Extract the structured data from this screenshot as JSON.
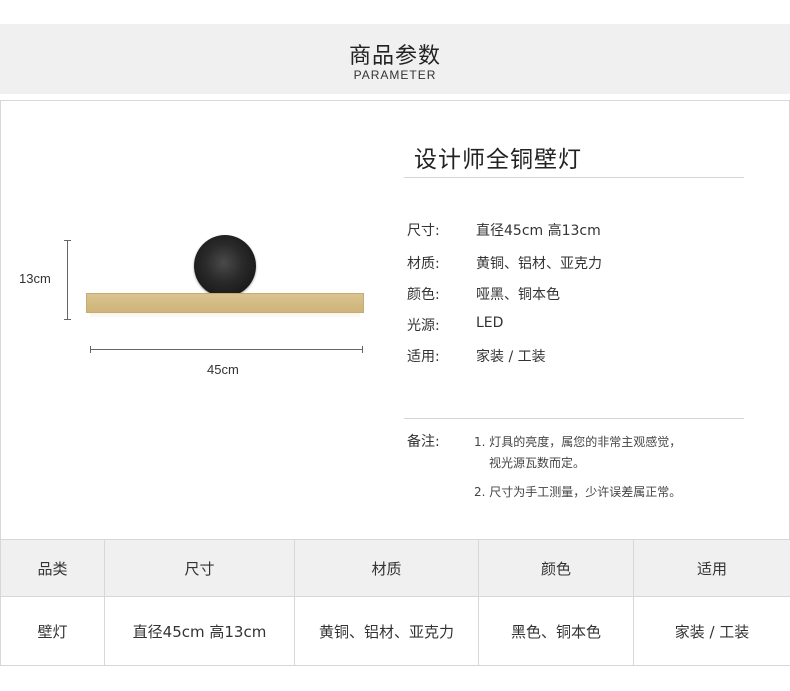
{
  "header": {
    "title": "商品参数",
    "subtitle": "PARAMETER"
  },
  "illustration": {
    "height_label": "13cm",
    "width_label": "45cm"
  },
  "product": {
    "title": "设计师全铜壁灯",
    "specs": [
      {
        "label": "尺寸:",
        "value": "直径45cm 高13cm"
      },
      {
        "label": "材质:",
        "value": "黄铜、铝材、亚克力"
      },
      {
        "label": "颜色:",
        "value": "哑黑、铜本色"
      },
      {
        "label": "光源:",
        "value": "LED"
      },
      {
        "label": "适用:",
        "value": "家装 / 工装"
      }
    ],
    "notes": {
      "label": "备注:",
      "lines": [
        "1. 灯具的亮度，属您的非常主观感觉，",
        "视光源瓦数而定。",
        "2. 尺寸为手工测量，少许误差属正常。"
      ]
    }
  },
  "table": {
    "headers": [
      "品类",
      "尺寸",
      "材质",
      "颜色",
      "适用"
    ],
    "rows": [
      [
        "壁灯",
        "直径45cm 高13cm",
        "黄铜、铝材、亚克力",
        "黑色、铜本色",
        "家装 / 工装"
      ]
    ]
  },
  "colors": {
    "header_bg": "#f0f0f0",
    "brass": "#d9c38f",
    "disc": "#1b1b1b",
    "border": "#d7d7d7"
  }
}
